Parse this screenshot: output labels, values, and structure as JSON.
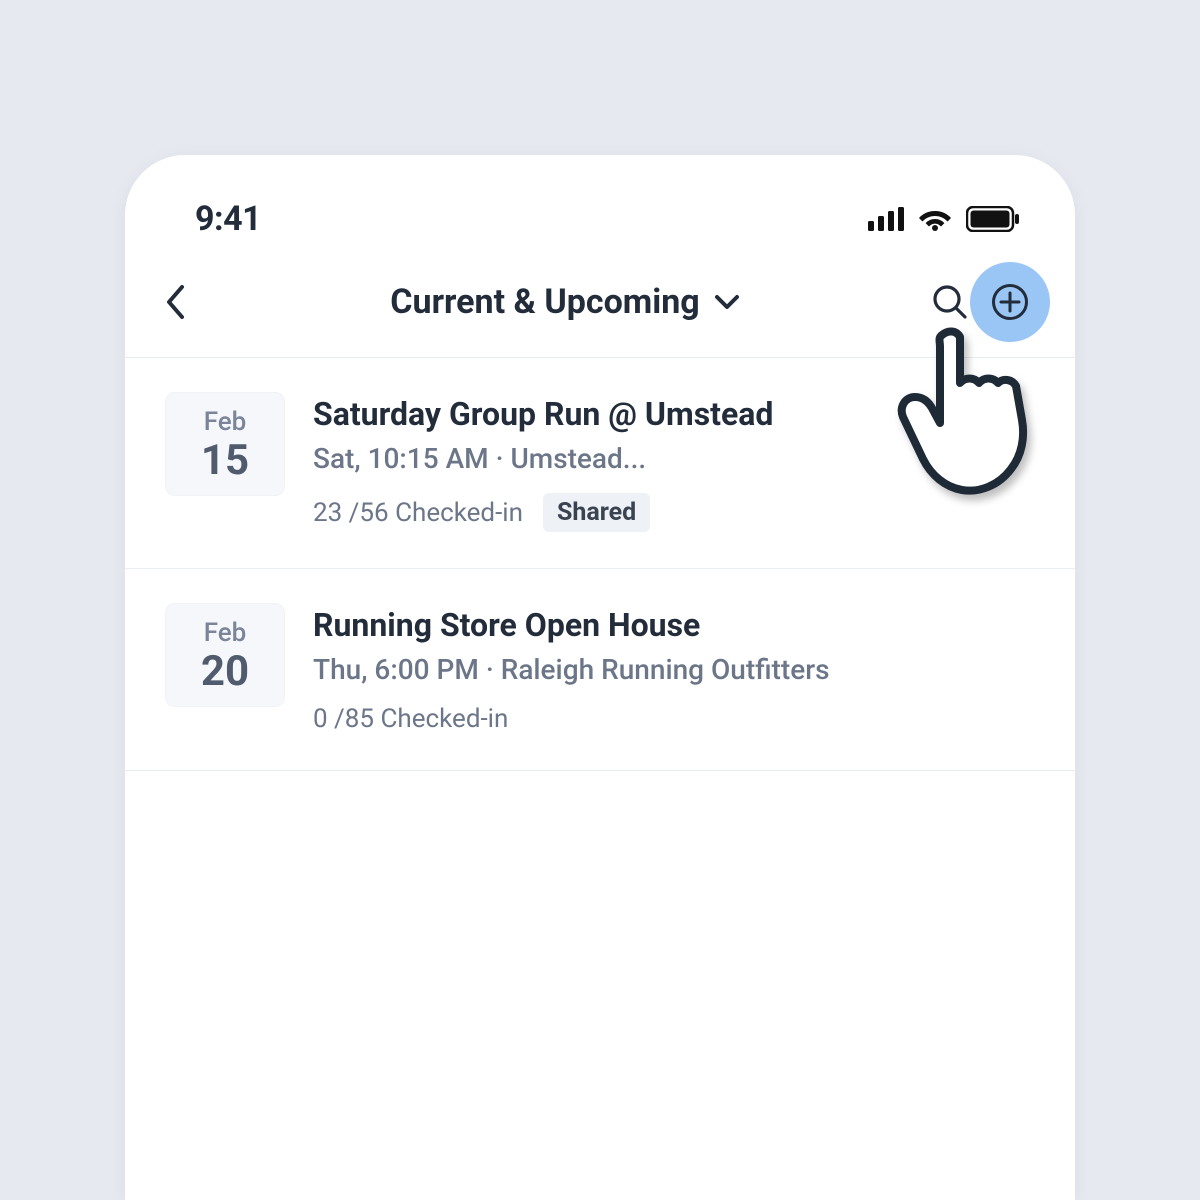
{
  "statusbar": {
    "time": "9:41"
  },
  "navbar": {
    "title": "Current & Upcoming"
  },
  "events": [
    {
      "month": "Feb",
      "day": "15",
      "title": "Saturday Group Run @ Umstead",
      "subtitle": "Sat, 10:15 AM · Umstead...",
      "checkin": "23 /56 Checked-in",
      "badge": "Shared"
    },
    {
      "month": "Feb",
      "day": "20",
      "title": "Running Store Open House",
      "subtitle": "Thu, 6:00 PM · Raleigh Running Outfitters",
      "checkin": "0 /85 Checked-in",
      "badge": ""
    }
  ]
}
